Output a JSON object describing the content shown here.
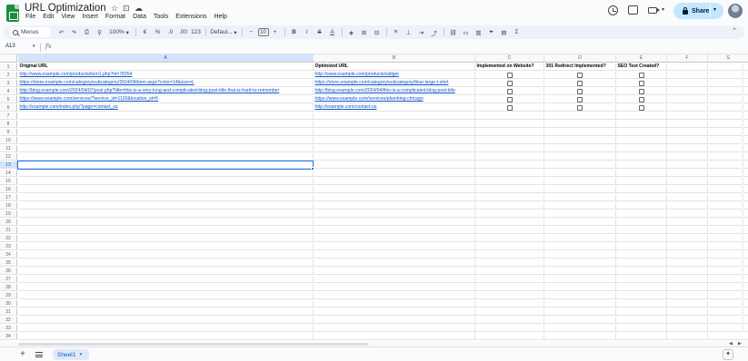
{
  "doc": {
    "title": "URL Optimization"
  },
  "menus": [
    "File",
    "Edit",
    "View",
    "Insert",
    "Format",
    "Data",
    "Tools",
    "Extensions",
    "Help"
  ],
  "share": {
    "label": "Share"
  },
  "toolbar": {
    "search_placeholder": "Menus",
    "zoom": "100%",
    "currency": "€",
    "percent": "%",
    "dec_less": ".0",
    "dec_more": ".00",
    "number_format": "123",
    "font": "Defaul...",
    "font_size": "10",
    "minus": "−",
    "plus": "+",
    "bold": "B",
    "italic": "I",
    "strike": "S",
    "text_color": "A",
    "functions": "Σ"
  },
  "formula_bar": {
    "name_box": "A13",
    "fx": "fx",
    "value": ""
  },
  "grid": {
    "columns": [
      "A",
      "B",
      "C",
      "D",
      "E",
      "F",
      "G"
    ],
    "selected_column": "A",
    "selected_row": 13,
    "headers": [
      "Original URL",
      "Optimized URL",
      "Implemented on Website?",
      "301 Redirect Implemented?",
      "SEO Test Created?"
    ],
    "rows": [
      {
        "original": "http://www.example.com/products/item1.php?id=78354",
        "optimized": "http://www.example.com/products/widget"
      },
      {
        "original": "https://store.example.com/category/subcategory/2024/04/item.aspx?color=14&size=L",
        "optimized": "https://store.example.com/category/subcategory/blue-large-t-shirt"
      },
      {
        "original": "http://blog.example.com/2024/04/07/post.php?title=this-is-a-very-long-and-complicated-blog-post-title-that-is-hard-to-remember",
        "optimized": "http://blog.example.com/2024/04/this-is-a-complicated-blog-post-title"
      },
      {
        "original": "https://www.example.com/services/?service_id=1120&location_id=5",
        "optimized": "https://www.example.com/services/plumbing-chicago"
      },
      {
        "original": "http://example.com/index.php?page=contact_us",
        "optimized": "http://example.com/contact-us"
      }
    ],
    "checkboxes": [
      [
        false,
        false,
        false
      ],
      [
        false,
        false,
        false
      ],
      [
        false,
        false,
        false
      ],
      [
        false,
        false,
        false
      ],
      [
        false,
        false,
        false
      ]
    ],
    "row_numbers": [
      1,
      2,
      3,
      4,
      5,
      6,
      7,
      8,
      9,
      10,
      11,
      12,
      13,
      14,
      15,
      16,
      17,
      18,
      19,
      20,
      21,
      22,
      23,
      24,
      25,
      26,
      27,
      28,
      29,
      30,
      31,
      32,
      33,
      34
    ]
  },
  "sheets": [
    {
      "name": "Sheet1",
      "active": true
    }
  ],
  "colors": {
    "accent": "#1a73e8",
    "link": "#1155cc",
    "share_bg": "#c2e7ff",
    "logo_green": "#1e8e3e"
  }
}
